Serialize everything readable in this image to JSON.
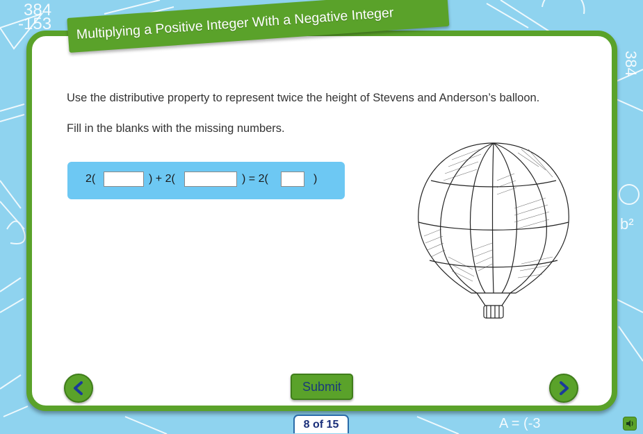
{
  "title": "Multiplying a Positive Integer With a Negative Integer",
  "instructions": {
    "line1": "Use the distributive property to represent twice the height of Stevens and Anderson’s balloon.",
    "line2": "Fill in the blanks with the missing numbers."
  },
  "equation": {
    "part1": "2(",
    "part2": ") + 2(",
    "part3": ") = 2(",
    "part4": ")",
    "blanks": [
      "",
      "",
      ""
    ]
  },
  "buttons": {
    "submit": "Submit"
  },
  "pagination": {
    "label": "8 of 15",
    "current": 8,
    "total": 15
  },
  "icons": {
    "prev": "chevron-left-icon",
    "next": "chevron-right-icon",
    "audio": "speaker-icon",
    "illustration": "hot-air-balloon-illustration"
  },
  "background_doodles": {
    "top_left": [
      "384",
      "-153"
    ],
    "top_right": "384",
    "right_middle": "b²",
    "bottom_right": "A = (-3"
  },
  "colors": {
    "background": "#8fd3ef",
    "frame_green": "#5aa22a",
    "equation_panel": "#6dc8f3",
    "nav_arrow": "#1a3a9a",
    "page_counter_text": "#1a2f7a"
  }
}
